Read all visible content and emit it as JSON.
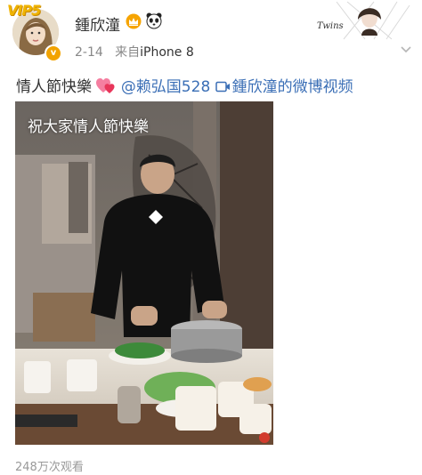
{
  "header": {
    "vip_label": "VIP5",
    "username": "鍾欣潼",
    "date": "2-14",
    "source_prefix": "来自",
    "device": "iPhone 8",
    "decoration_text": "Twins"
  },
  "post": {
    "text": "情人節快樂",
    "mention": "@赖弘国528",
    "video_link": "鍾欣潼的微博视频"
  },
  "video": {
    "caption": "祝大家情人節快樂",
    "view_count": "248万次观看"
  },
  "colors": {
    "link": "#3b6fb6",
    "meta_text": "#888888",
    "vip_gold": "#f0b400"
  },
  "icons": [
    "crown-icon",
    "panda-icon",
    "heart-icon",
    "video-icon",
    "chevron-down-icon",
    "verified-icon"
  ]
}
